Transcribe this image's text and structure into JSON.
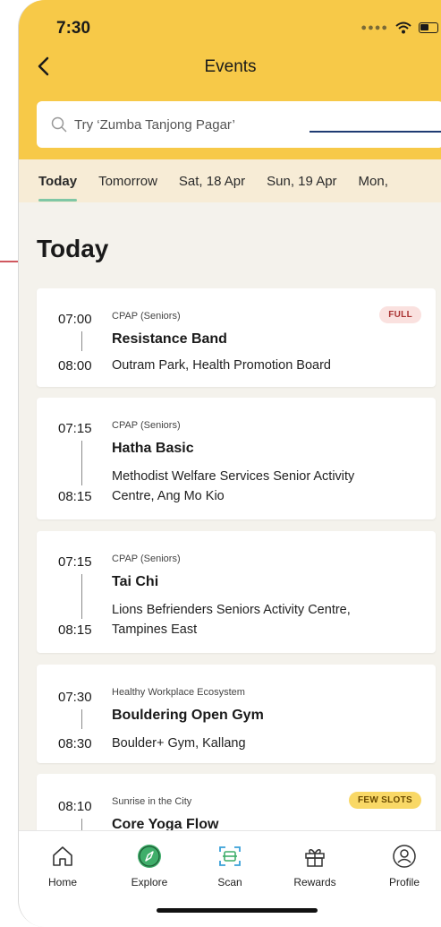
{
  "status": {
    "time": "7:30"
  },
  "header": {
    "title": "Events"
  },
  "search": {
    "placeholder": "Try ‘Zumba Tanjong Pagar’"
  },
  "tabs": [
    {
      "label": "Today",
      "active": true
    },
    {
      "label": "Tomorrow"
    },
    {
      "label": "Sat, 18 Apr"
    },
    {
      "label": "Sun, 19 Apr"
    },
    {
      "label": "Mon,"
    }
  ],
  "section": {
    "heading": "Today"
  },
  "events": [
    {
      "start": "07:00",
      "end": "08:00",
      "org": "CPAP (Seniors)",
      "title": "Resistance Band",
      "location": [
        "Outram Park, Health Promotion Board"
      ],
      "badge": "FULL"
    },
    {
      "start": "07:15",
      "end": "08:15",
      "org": "CPAP (Seniors)",
      "title": "Hatha Basic",
      "location": [
        "Methodist Welfare Services Senior Activity",
        "Centre, Ang Mo Kio"
      ]
    },
    {
      "start": "07:15",
      "end": "08:15",
      "org": "CPAP (Seniors)",
      "title": "Tai Chi",
      "location": [
        "Lions Befrienders Seniors Activity Centre,",
        "Tampines East"
      ]
    },
    {
      "start": "07:30",
      "end": "08:30",
      "org": "Healthy Workplace Ecosystem",
      "title": "Bouldering Open Gym",
      "location": [
        "Boulder+ Gym, Kallang"
      ]
    },
    {
      "start": "08:10",
      "org": "Sunrise in the City",
      "title": "Core Yoga Flow",
      "badge": "FEW SLOTS"
    }
  ],
  "nav": {
    "home": "Home",
    "explore": "Explore",
    "scan": "Scan",
    "rewards": "Rewards",
    "profile": "Profile"
  },
  "colors": {
    "header": "#f7c948",
    "tabs_bg": "#f7ecd6",
    "tab_indicator": "#7fc7a5",
    "explore_icon": "#3fae6a",
    "annotation_arrow": "#c0202a"
  }
}
